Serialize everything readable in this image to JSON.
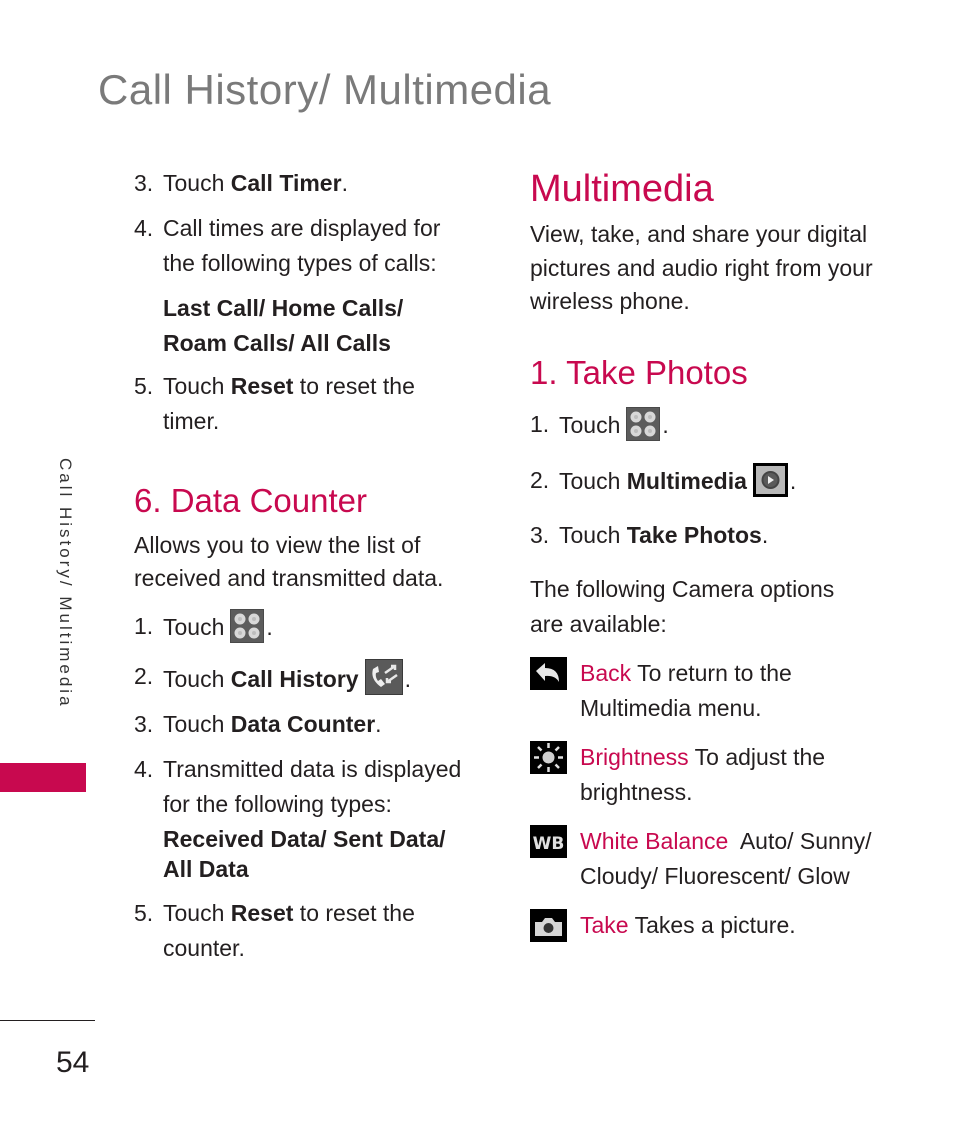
{
  "header": {
    "title": "Call History/ Multimedia"
  },
  "side_tab": {
    "label": "Call History/ Multimedia",
    "accent_color": "#c8094f"
  },
  "footer": {
    "page_number": "54"
  },
  "left_column": {
    "timer_steps": [
      {
        "num": "3.",
        "prefix": "Touch ",
        "bold": "Call Timer",
        "suffix": "."
      },
      {
        "num": "4.",
        "text": "Call times are displayed for the following types of calls:"
      }
    ],
    "timer_types": "Last Call/ Home Calls/ Roam Calls/ All Calls",
    "timer_reset": {
      "num": "5.",
      "prefix": "Touch ",
      "bold": "Reset",
      "suffix": " to reset the timer."
    },
    "data_counter": {
      "heading": "6. Data Counter",
      "intro": "Allows you to view the list of received and transmitted data.",
      "steps": [
        {
          "num": "1.",
          "prefix": "Touch",
          "icon": "menu-grid-icon",
          "suffix": "."
        },
        {
          "num": "2.",
          "prefix": "Touch ",
          "bold": "Call History",
          "icon": "call-history-icon",
          "suffix": "."
        },
        {
          "num": "3.",
          "prefix": "Touch ",
          "bold": "Data Counter",
          "suffix": "."
        },
        {
          "num": "4.",
          "text": "Transmitted data is displayed for the following types:"
        }
      ],
      "types": "Received Data/ Sent Data/ All Data",
      "reset": {
        "num": "5.",
        "prefix": "Touch ",
        "bold": "Reset",
        "suffix": " to reset the counter."
      }
    }
  },
  "right_column": {
    "heading": "Multimedia",
    "intro": "View, take, and share your digital pictures and audio right from your wireless phone.",
    "take_photos": {
      "heading": "1. Take Photos",
      "steps": [
        {
          "num": "1.",
          "prefix": "Touch",
          "icon": "menu-grid-icon",
          "suffix": "."
        },
        {
          "num": "2.",
          "prefix": "Touch ",
          "bold": "Multimedia",
          "icon": "multimedia-icon",
          "suffix": "."
        },
        {
          "num": "3.",
          "prefix": "Touch ",
          "bold": "Take Photos",
          "suffix": "."
        }
      ],
      "options_intro": "The following Camera options are available:",
      "options": [
        {
          "icon": "back-arrow-icon",
          "label": "Back",
          "desc": " To return to the Multimedia menu."
        },
        {
          "icon": "brightness-icon",
          "label": "Brightness",
          "desc": " To adjust the brightness."
        },
        {
          "icon": "white-balance-icon",
          "label": "White Balance",
          "desc": "  Auto/ Sunny/ Cloudy/ Fluorescent/ Glow"
        },
        {
          "icon": "camera-icon",
          "label": "Take",
          "desc": " Takes a picture."
        }
      ]
    }
  }
}
